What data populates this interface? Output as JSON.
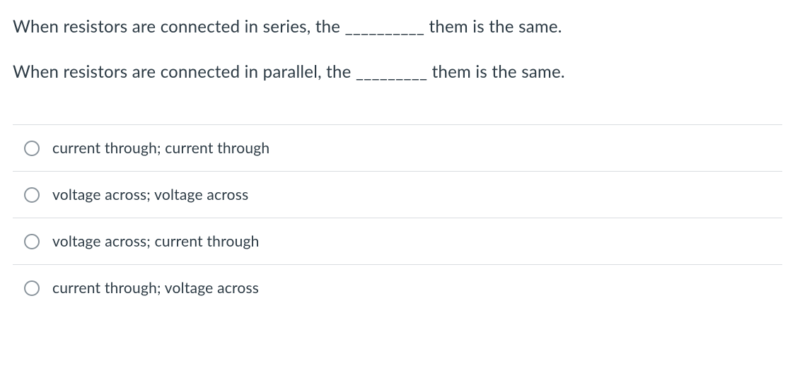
{
  "question": {
    "line1": "When resistors are connected in series, the __________ them is the same.",
    "line2": "When resistors are connected in parallel, the _________ them is the same."
  },
  "options": [
    {
      "label": "current through; current through"
    },
    {
      "label": "voltage across; voltage across"
    },
    {
      "label": "voltage across; current through"
    },
    {
      "label": "current through; voltage across"
    }
  ]
}
